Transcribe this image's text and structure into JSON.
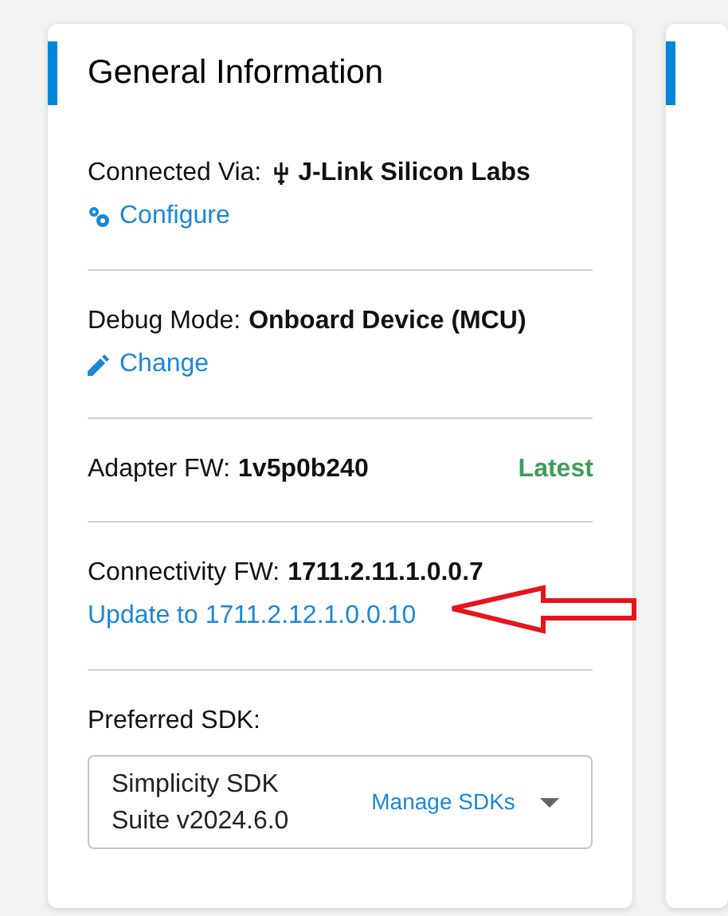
{
  "card": {
    "title": "General Information",
    "sections": [
      {
        "kind": "connection",
        "label": "Connected Via:",
        "value": "J-Link Silicon Labs",
        "link": "Configure"
      },
      {
        "kind": "debug",
        "label": "Debug Mode:",
        "value": "Onboard Device (MCU)",
        "link": "Change"
      },
      {
        "kind": "adapter",
        "label": "Adapter FW:",
        "value": "1v5p0b240",
        "status": "Latest"
      },
      {
        "kind": "connectivity",
        "label": "Connectivity FW:",
        "value": "1711.2.11.1.0.0.7",
        "link": "Update to 1711.2.12.1.0.0.10"
      },
      {
        "kind": "sdk",
        "label": "Preferred SDK:",
        "value": "Simplicity SDK Suite v2024.6.0",
        "action": "Manage SDKs"
      }
    ]
  }
}
